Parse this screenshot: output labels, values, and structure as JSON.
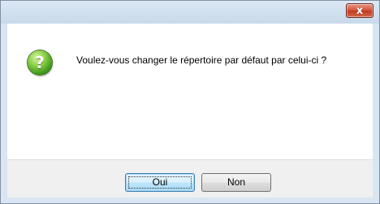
{
  "dialog": {
    "close_label": "x",
    "message": "Voulez-vous changer le répertoire par défaut par celui-ci ?",
    "icon": "question-icon",
    "icon_glyph": "?"
  },
  "buttons": {
    "yes_label": "Oui",
    "no_label": "Non"
  },
  "colors": {
    "frame": "#d9e6f2",
    "close_button": "#c13b22",
    "question_icon": "#3f9a19",
    "footer": "#f0f0f0"
  }
}
